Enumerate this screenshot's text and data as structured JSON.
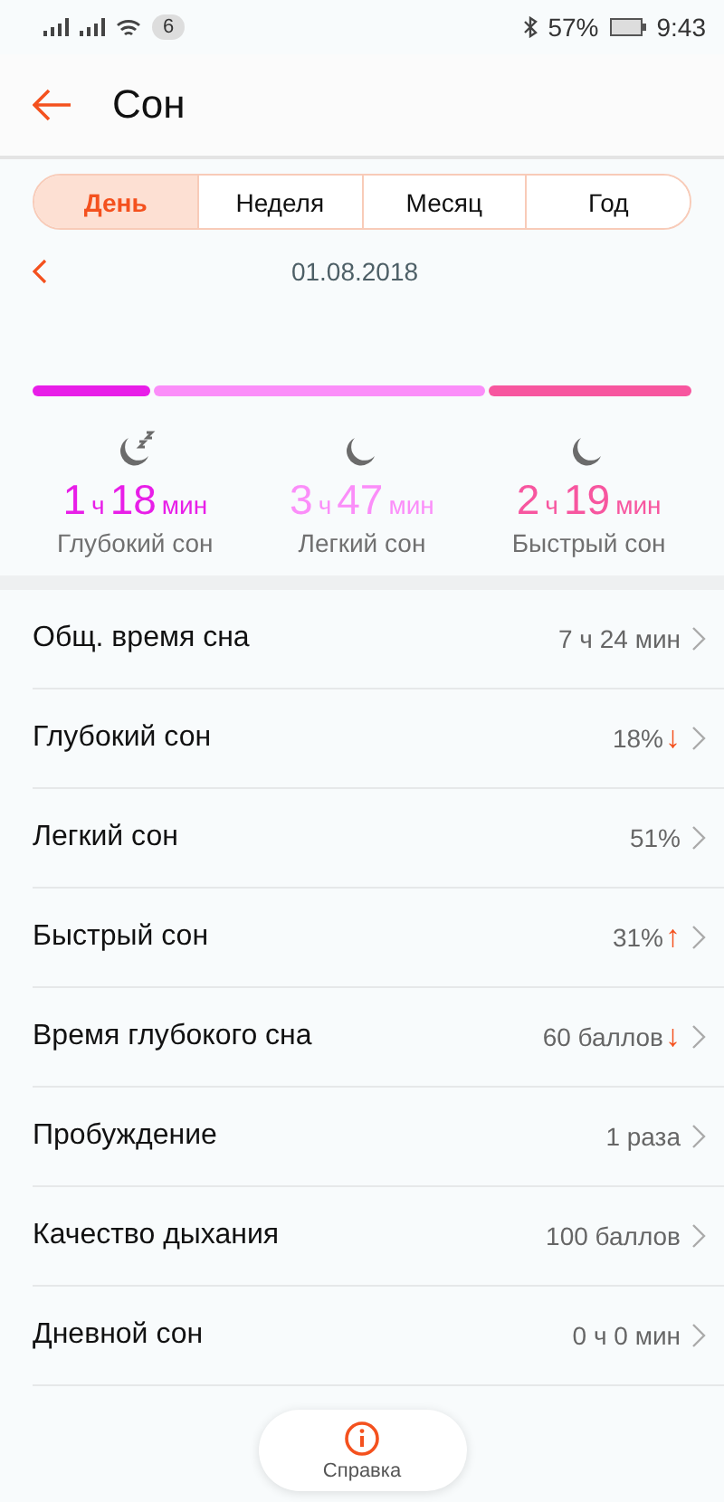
{
  "status_bar": {
    "notification_count": "6",
    "battery": "57%",
    "time": "9:43"
  },
  "header": {
    "title": "Сон"
  },
  "tabs": [
    {
      "label": "День",
      "selected": true
    },
    {
      "label": "Неделя",
      "selected": false
    },
    {
      "label": "Месяц",
      "selected": false
    },
    {
      "label": "Год",
      "selected": false
    }
  ],
  "date": "01.08.2018",
  "stages": [
    {
      "kind": "deep",
      "color": "#e81ee8",
      "hours": "1",
      "h_unit": "ч",
      "minutes": "18",
      "m_unit": "мин",
      "label": "Глубокий сон"
    },
    {
      "kind": "light",
      "color": "#fb8ef9",
      "hours": "3",
      "h_unit": "ч",
      "minutes": "47",
      "m_unit": "мин",
      "label": "Легкий сон"
    },
    {
      "kind": "rem",
      "color": "#f7569f",
      "hours": "2",
      "h_unit": "ч",
      "minutes": "19",
      "m_unit": "мин",
      "label": "Быстрый сон"
    }
  ],
  "rows": [
    {
      "label": "Общ. время сна",
      "value": "7 ч 24 мин"
    },
    {
      "label": "Глубокий сон",
      "value": "18%",
      "trend": "↓"
    },
    {
      "label": "Легкий сон",
      "value": "51%"
    },
    {
      "label": "Быстрый сон",
      "value": "31%",
      "trend": "↑"
    },
    {
      "label": "Время глубокого сна",
      "value": "60 баллов",
      "trend": "↓"
    },
    {
      "label": "Пробуждение",
      "value": "1 раза"
    },
    {
      "label": "Качество дыхания",
      "value": "100 баллов"
    },
    {
      "label": "Дневной сон",
      "value": "0 ч 0 мин"
    }
  ],
  "help_button": {
    "label": "Справка"
  }
}
